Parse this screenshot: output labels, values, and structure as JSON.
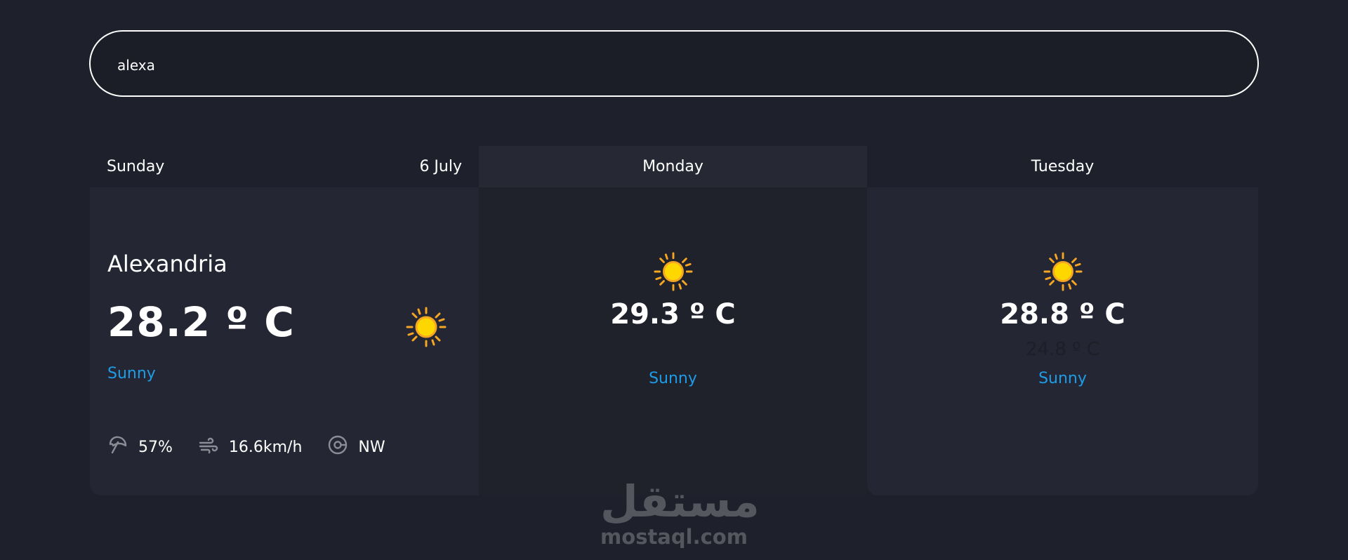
{
  "search": {
    "value": "alexa"
  },
  "today": {
    "day": "Sunday",
    "date": "6 July",
    "city": "Alexandria",
    "temp": "28.2 º C",
    "condition": "Sunny",
    "icon": "sun-icon",
    "humidity": "57%",
    "wind_speed": "16.6km/h",
    "wind_dir": "NW"
  },
  "forecast": [
    {
      "day": "Monday",
      "max_temp": "29.3 º C",
      "min_temp": "",
      "condition": "Sunny",
      "icon": "sun-icon"
    },
    {
      "day": "Tuesday",
      "max_temp": "28.8 º C",
      "min_temp": "24.8 º C",
      "condition": "Sunny",
      "icon": "sun-icon"
    }
  ],
  "watermark": {
    "arabic": "مستقل",
    "latin": "mostaql.com"
  },
  "colors": {
    "background": "#1e202b",
    "accent": "#1e9ce8",
    "sun": "#ffd700"
  }
}
